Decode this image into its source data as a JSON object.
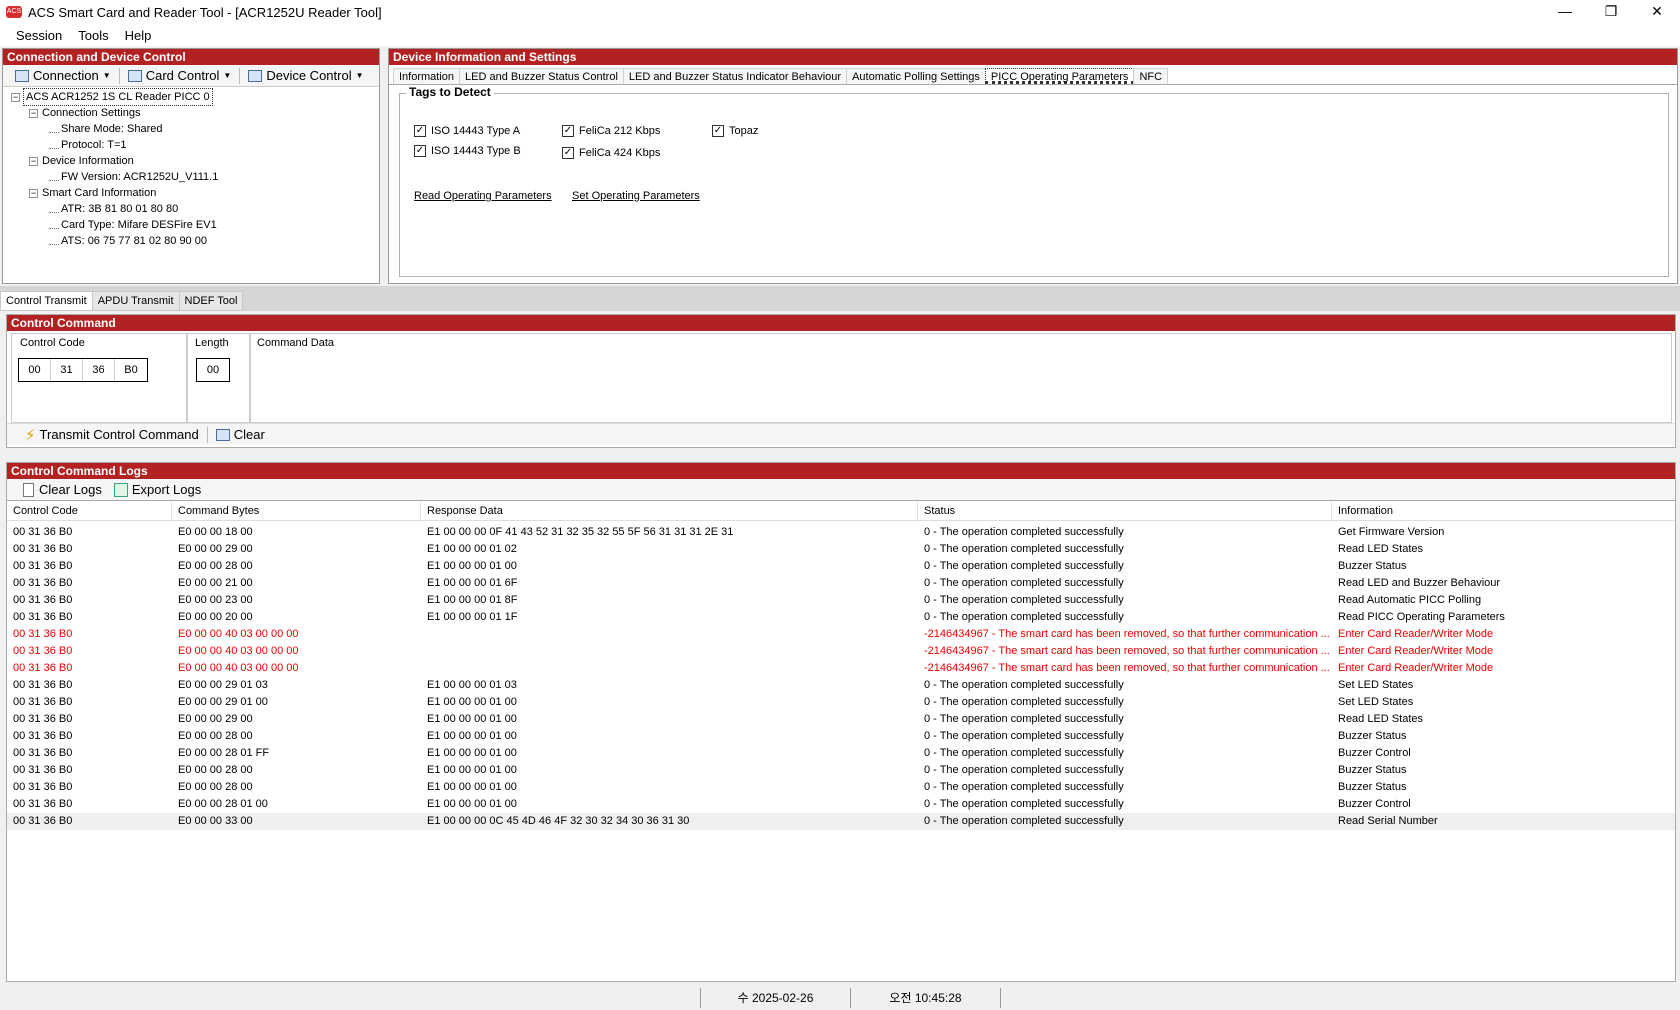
{
  "window": {
    "title": "ACS Smart Card and Reader Tool - [ACR1252U Reader Tool]",
    "icon": "ACS",
    "minimize": "—",
    "restore": "❐",
    "close": "✕"
  },
  "menu": [
    "Session",
    "Tools",
    "Help"
  ],
  "left_panel": {
    "header": "Connection and Device Control",
    "toolbar": [
      "Connection",
      "Card Control",
      "Device Control"
    ],
    "tree": {
      "root": "ACS ACR1252 1S CL Reader PICC 0",
      "connection_settings": "Connection Settings",
      "share_mode": "Share Mode: Shared",
      "protocol": "Protocol: T=1",
      "device_information": "Device Information",
      "fw_version": "FW Version: ACR1252U_V111.1",
      "smart_card_information": "Smart Card Information",
      "atr": "ATR: 3B 81 80 01 80 80",
      "card_type": "Card Type: Mifare DESFire EV1",
      "ats": "ATS: 06 75 77 81 02 80 90 00"
    }
  },
  "right_panel": {
    "header": "Device Information and Settings",
    "tabs": [
      "Information",
      "LED and Buzzer Status Control",
      "LED and Buzzer Status Indicator Behaviour",
      "Automatic Polling Settings",
      "PICC Operating Parameters",
      "NFC"
    ],
    "group_title": "Tags to Detect",
    "checkboxes": {
      "iso_a": "ISO 14443 Type A",
      "iso_b": "ISO 14443 Type B",
      "felica_212": "FeliCa 212 Kbps",
      "felica_424": "FeliCa 424 Kbps",
      "topaz": "Topaz"
    },
    "read_link": "Read Operating Parameters",
    "set_link": "Set Operating Parameters"
  },
  "bottom_tabs": [
    "Control Transmit",
    "APDU Transmit",
    "NDEF Tool"
  ],
  "control_command": {
    "header": "Control Command",
    "control_code_label": "Control Code",
    "control_code": [
      "00",
      "31",
      "36",
      "B0"
    ],
    "length_label": "Length",
    "length": "00",
    "command_data_label": "Command Data",
    "transmit_label": "Transmit Control Command",
    "clear_label": "Clear"
  },
  "logs": {
    "header": "Control Command Logs",
    "clear_logs": "Clear Logs",
    "export_logs": "Export Logs",
    "columns": [
      "Control Code",
      "Command Bytes",
      "Response Data",
      "Status",
      "Information"
    ],
    "rows": [
      {
        "code": "00 31 36 B0",
        "cmd": "E0 00 00 18 00",
        "resp": "E1 00 00 00 0F 41 43 52 31 32 35 32 55 5F 56 31 31 31 2E 31",
        "status": "0 - The operation completed successfully",
        "info": "Get Firmware Version"
      },
      {
        "code": "00 31 36 B0",
        "cmd": "E0 00 00 29 00",
        "resp": "E1 00 00 00 01 02",
        "status": "0 - The operation completed successfully",
        "info": "Read LED States"
      },
      {
        "code": "00 31 36 B0",
        "cmd": "E0 00 00 28 00",
        "resp": "E1 00 00 00 01 00",
        "status": "0 - The operation completed successfully",
        "info": "Buzzer Status"
      },
      {
        "code": "00 31 36 B0",
        "cmd": "E0 00 00 21 00",
        "resp": "E1 00 00 00 01 6F",
        "status": "0 - The operation completed successfully",
        "info": "Read LED and Buzzer Behaviour"
      },
      {
        "code": "00 31 36 B0",
        "cmd": "E0 00 00 23 00",
        "resp": "E1 00 00 00 01 8F",
        "status": "0 - The operation completed successfully",
        "info": "Read Automatic PICC Polling"
      },
      {
        "code": "00 31 36 B0",
        "cmd": "E0 00 00 20 00",
        "resp": "E1 00 00 00 01 1F",
        "status": "0 - The operation completed successfully",
        "info": "Read PICC Operating Parameters"
      },
      {
        "code": "00 31 36 B0",
        "cmd": "E0 00 00 40 03 00 00 00",
        "resp": "",
        "status": "-2146434967 - The smart card has been removed, so that further communication ...",
        "info": "Enter Card Reader/Writer Mode",
        "error": true
      },
      {
        "code": "00 31 36 B0",
        "cmd": "E0 00 00 40 03 00 00 00",
        "resp": "",
        "status": "-2146434967 - The smart card has been removed, so that further communication ...",
        "info": "Enter Card Reader/Writer Mode",
        "error": true
      },
      {
        "code": "00 31 36 B0",
        "cmd": "E0 00 00 40 03 00 00 00",
        "resp": "",
        "status": "-2146434967 - The smart card has been removed, so that further communication ...",
        "info": "Enter Card Reader/Writer Mode",
        "error": true
      },
      {
        "code": "00 31 36 B0",
        "cmd": "E0 00 00 29 01 03",
        "resp": "E1 00 00 00 01 03",
        "status": "0 - The operation completed successfully",
        "info": "Set LED States"
      },
      {
        "code": "00 31 36 B0",
        "cmd": "E0 00 00 29 01 00",
        "resp": "E1 00 00 00 01 00",
        "status": "0 - The operation completed successfully",
        "info": "Set LED States"
      },
      {
        "code": "00 31 36 B0",
        "cmd": "E0 00 00 29 00",
        "resp": "E1 00 00 00 01 00",
        "status": "0 - The operation completed successfully",
        "info": "Read LED States"
      },
      {
        "code": "00 31 36 B0",
        "cmd": "E0 00 00 28 00",
        "resp": "E1 00 00 00 01 00",
        "status": "0 - The operation completed successfully",
        "info": "Buzzer Status"
      },
      {
        "code": "00 31 36 B0",
        "cmd": "E0 00 00 28 01 FF",
        "resp": "E1 00 00 00 01 00",
        "status": "0 - The operation completed successfully",
        "info": "Buzzer Control"
      },
      {
        "code": "00 31 36 B0",
        "cmd": "E0 00 00 28 00",
        "resp": "E1 00 00 00 01 00",
        "status": "0 - The operation completed successfully",
        "info": "Buzzer Status"
      },
      {
        "code": "00 31 36 B0",
        "cmd": "E0 00 00 28 00",
        "resp": "E1 00 00 00 01 00",
        "status": "0 - The operation completed successfully",
        "info": "Buzzer Status"
      },
      {
        "code": "00 31 36 B0",
        "cmd": "E0 00 00 28 01 00",
        "resp": "E1 00 00 00 01 00",
        "status": "0 - The operation completed successfully",
        "info": "Buzzer Control"
      },
      {
        "code": "00 31 36 B0",
        "cmd": "E0 00 00 33 00",
        "resp": "E1 00 00 00 0C 45 4D 46 4F 32 30 32 34 30 36 31 30",
        "status": "0 - The operation completed successfully",
        "info": "Read Serial Number",
        "selected": true
      }
    ]
  },
  "statusbar": {
    "date": "수 2025-02-26",
    "time": "오전 10:45:28"
  },
  "colors": {
    "header_red": "#b22222",
    "error_text": "#e00000"
  }
}
